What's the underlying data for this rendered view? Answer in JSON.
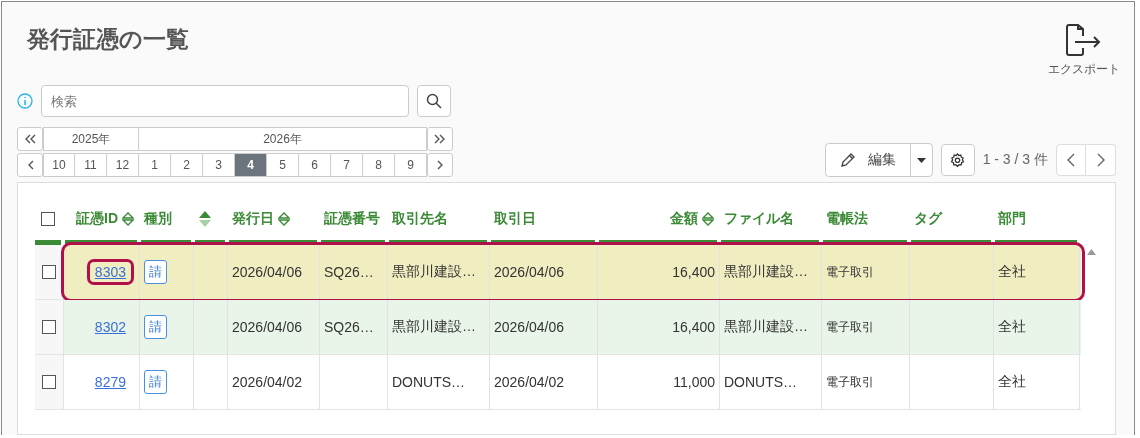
{
  "title": "発行証憑の一覧",
  "export_button": {
    "label": "エクスポート"
  },
  "search": {
    "placeholder": "検索"
  },
  "period": {
    "years": [
      {
        "label": "2025年"
      },
      {
        "label": "2026年"
      }
    ],
    "months": [
      {
        "label": "10",
        "selected": false
      },
      {
        "label": "11",
        "selected": false
      },
      {
        "label": "12",
        "selected": false
      },
      {
        "label": "1",
        "selected": false
      },
      {
        "label": "2",
        "selected": false
      },
      {
        "label": "3",
        "selected": false
      },
      {
        "label": "4",
        "selected": true
      },
      {
        "label": "5",
        "selected": false
      },
      {
        "label": "6",
        "selected": false
      },
      {
        "label": "7",
        "selected": false
      },
      {
        "label": "8",
        "selected": false
      },
      {
        "label": "9",
        "selected": false
      }
    ]
  },
  "toolbar": {
    "edit_button": "編集",
    "page_info": "1 - 3 / 3 件"
  },
  "table": {
    "all_checked": false,
    "columns": [
      {
        "label": "証憑ID",
        "sorted": false
      },
      {
        "label": "種別"
      },
      {
        "sorted": true
      },
      {
        "label": "発行日",
        "sorted": false
      },
      {
        "label": "証憑番号"
      },
      {
        "label": "取引先名"
      },
      {
        "label": "取引日"
      },
      {
        "label": "金額",
        "sorted": false
      },
      {
        "label": "ファイル名"
      },
      {
        "label": "電帳法"
      },
      {
        "label": "タグ"
      },
      {
        "label": "部門"
      }
    ],
    "rows": [
      {
        "checked": false,
        "selected": true,
        "hovered": false,
        "id_marked": true,
        "cells": [
          "8303",
          "請",
          "",
          "2026/04/06",
          "SQ26…",
          "黒部川建設…",
          "2026/04/06",
          "16,400",
          "黒部川建設…",
          "電子取引",
          "",
          "全社"
        ]
      },
      {
        "checked": false,
        "selected": false,
        "hovered": true,
        "id_marked": false,
        "cells": [
          "8302",
          "請",
          "",
          "2026/04/06",
          "SQ26…",
          "黒部川建設…",
          "2026/04/06",
          "16,400",
          "黒部川建設…",
          "電子取引",
          "",
          "全社"
        ]
      },
      {
        "checked": false,
        "selected": false,
        "hovered": false,
        "id_marked": false,
        "cells": [
          "8279",
          "請",
          "",
          "2026/04/02",
          "",
          "DONUTS…",
          "2026/04/02",
          "11,000",
          "DONUTS…",
          "電子取引",
          "",
          "全社"
        ]
      }
    ]
  }
}
